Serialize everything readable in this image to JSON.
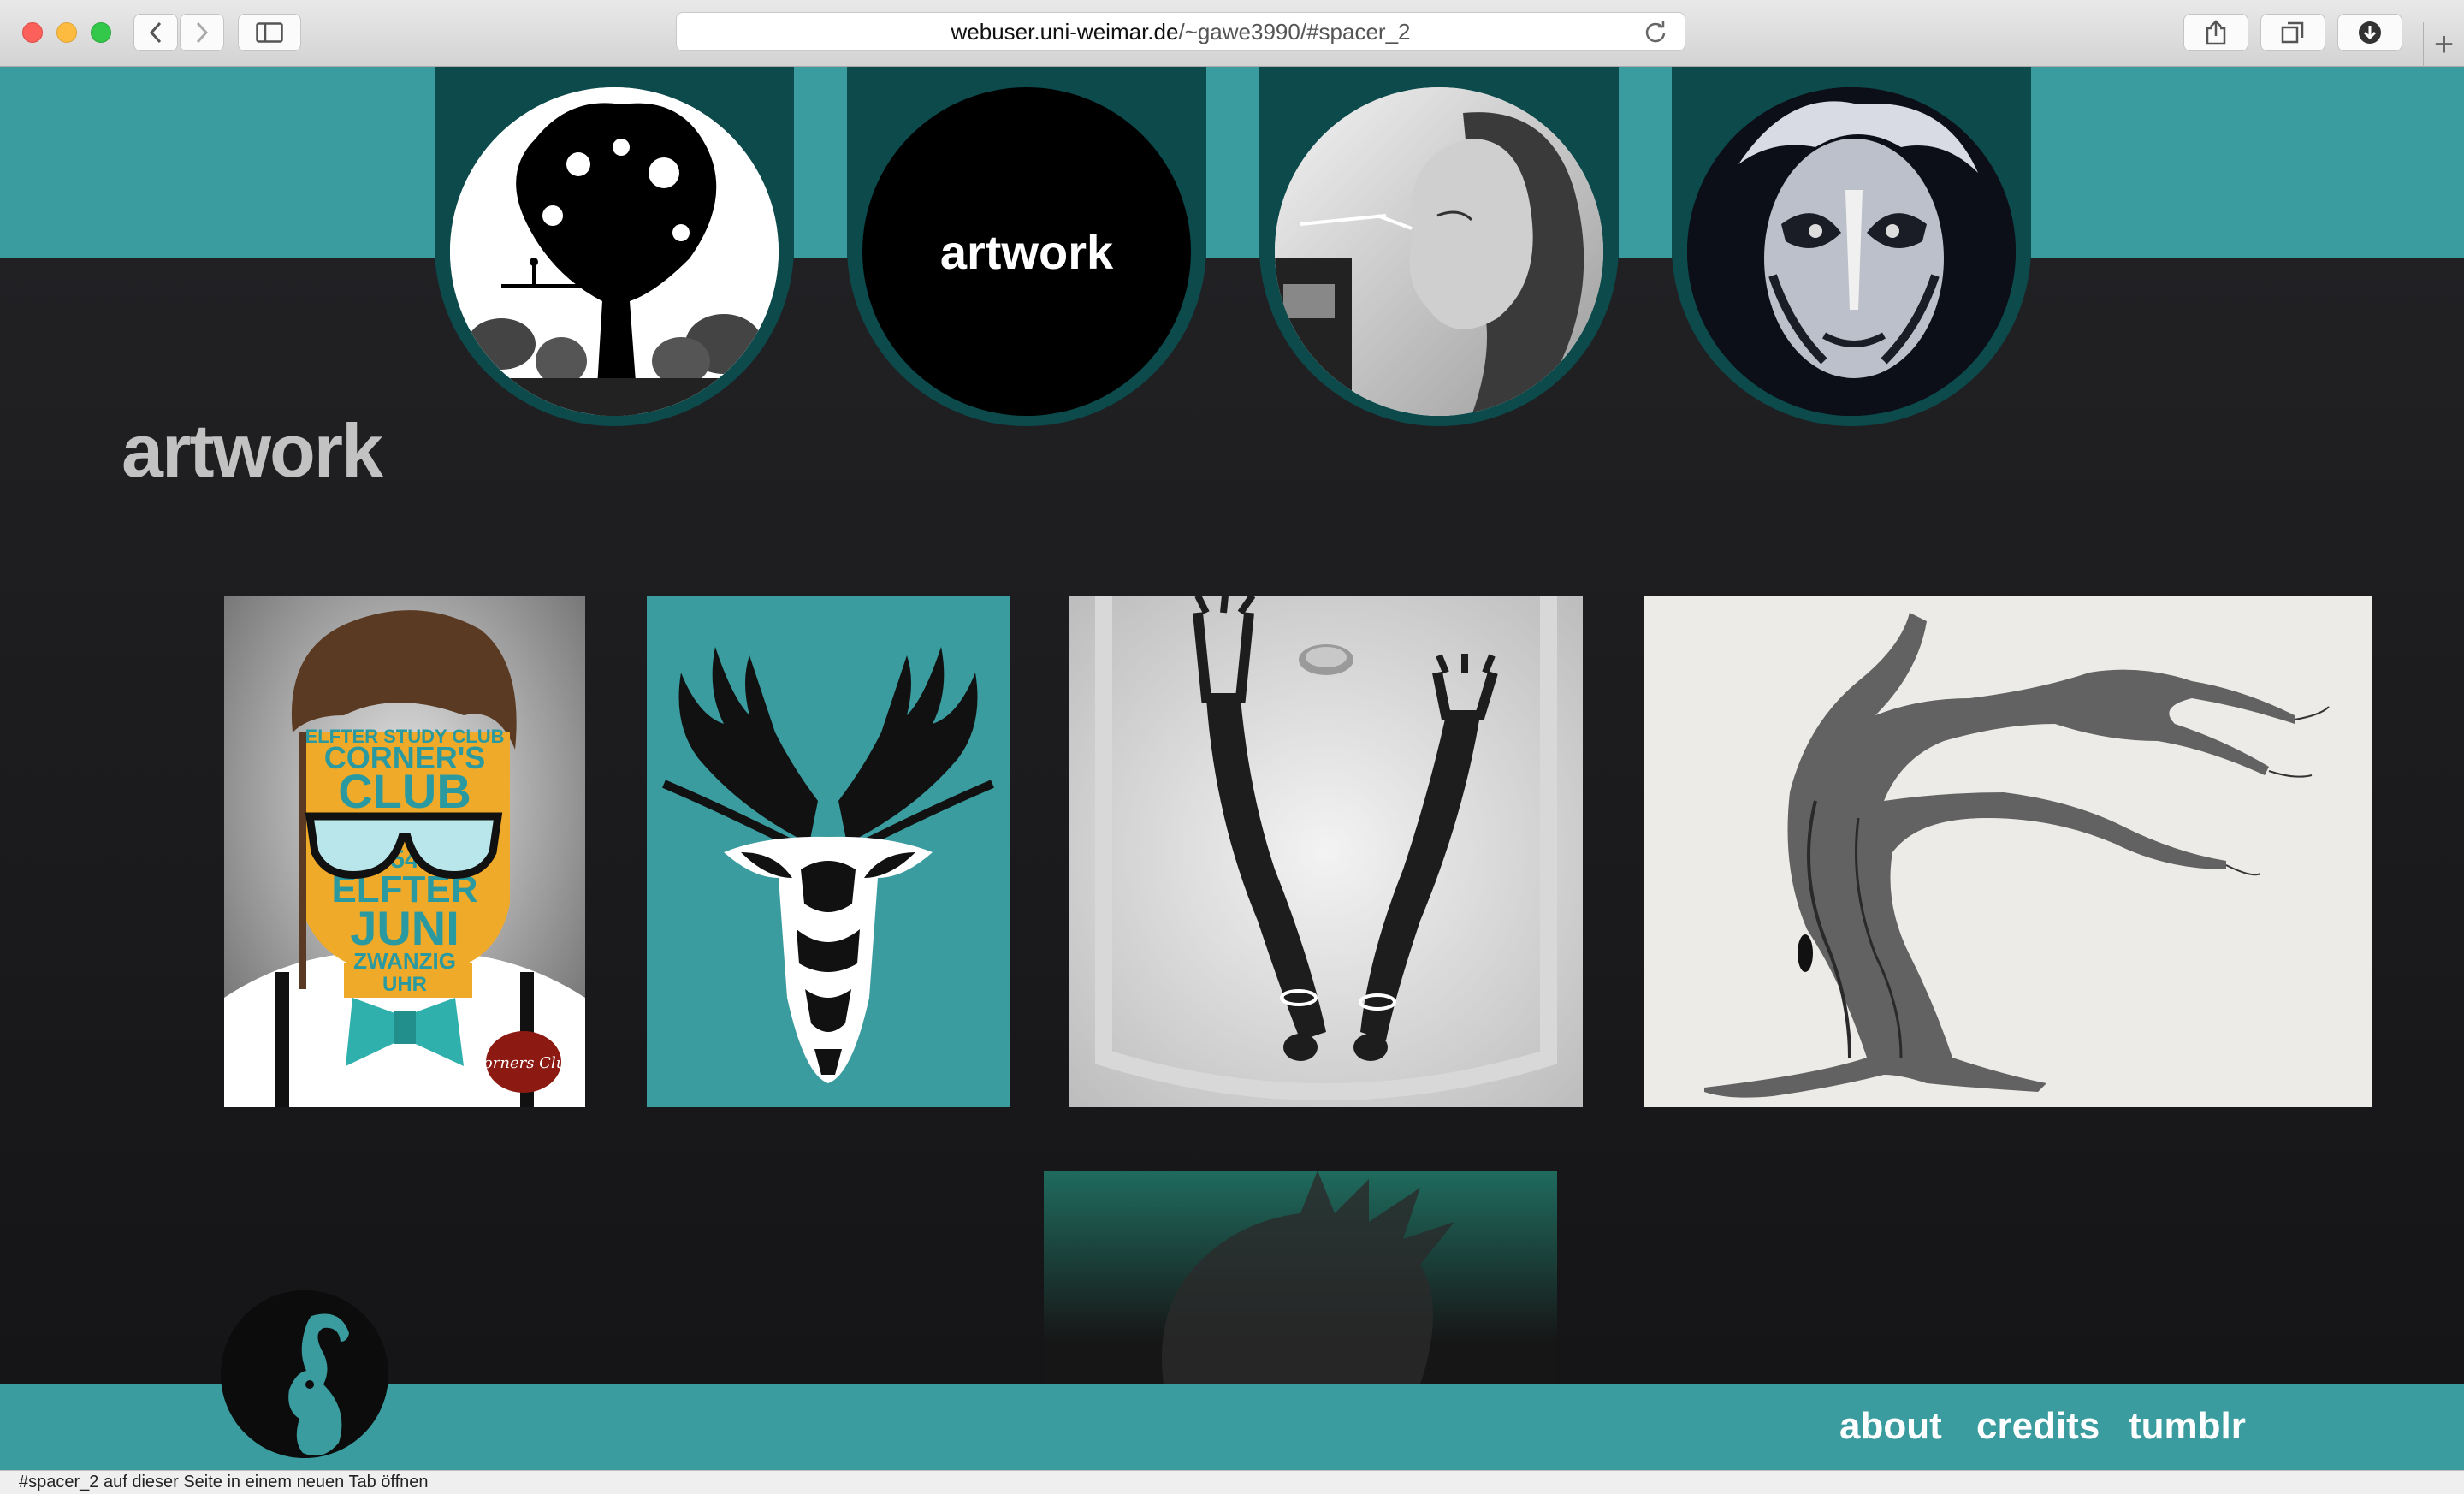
{
  "browser": {
    "url_host": "webuser.uni-weimar.de",
    "url_path": "/~gawe3990/#spacer_2",
    "status_text": "#spacer_2 auf dieser Seite in einem neuen Tab öffnen"
  },
  "nav": {
    "items": [
      {
        "label": "",
        "icon": "tree-silhouette-icon"
      },
      {
        "label": "artwork"
      },
      {
        "label": "",
        "icon": "girl-drinking-photo"
      },
      {
        "label": "",
        "icon": "face-paint-portrait"
      }
    ]
  },
  "section": {
    "title": "artwork"
  },
  "artworks": [
    {
      "caption": "",
      "text_lines": [
        "ELFTER STUDY CLUB",
        "CORNER'S",
        "CLUB",
        "54",
        "ELFTER",
        "JUNI",
        "ZWANZIG",
        "UHR"
      ],
      "badge": "Corners Club"
    },
    {
      "caption": ""
    },
    {
      "caption": ""
    },
    {
      "caption": ""
    }
  ],
  "footer": {
    "links": [
      "about",
      "credits",
      "tumblr"
    ]
  },
  "colors": {
    "teal": "#3a9c9f",
    "dark_teal": "#0c4a4c",
    "background": "#1b1b1d"
  }
}
